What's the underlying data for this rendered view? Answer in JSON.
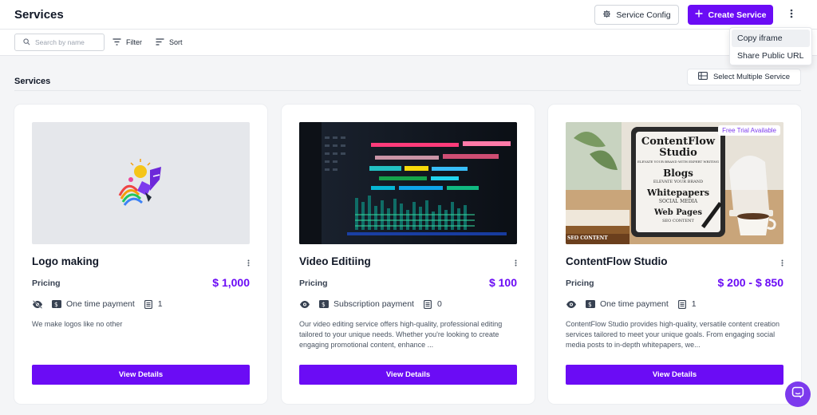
{
  "header": {
    "title": "Services",
    "service_config_label": "Service Config",
    "create_service_label": "Create Service"
  },
  "toolbar": {
    "search_placeholder": "Search by name",
    "filter_label": "Filter",
    "sort_label": "Sort"
  },
  "more_menu": {
    "items": [
      {
        "label": "Copy iframe"
      },
      {
        "label": "Share Public URL"
      }
    ]
  },
  "section": {
    "title": "Services",
    "select_multiple_label": "Select Multiple Service"
  },
  "cards": [
    {
      "title": "Logo making",
      "pricing_label": "Pricing",
      "price": "$ 1,000",
      "visibility_icon": "eye-off-icon",
      "payment_type": "One time payment",
      "count": "1",
      "description": "We make logos like no other",
      "button_label": "View Details"
    },
    {
      "title": "Video Editiing",
      "pricing_label": "Pricing",
      "price": "$ 100",
      "visibility_icon": "eye-icon",
      "payment_type": "Subscription payment",
      "count": "0",
      "description": "Our video editing service offers high-quality, professional editing tailored to your unique needs. Whether you're looking to create engaging promotional content, enhance ...",
      "button_label": "View Details"
    },
    {
      "title": "ContentFlow Studio",
      "pricing_label": "Pricing",
      "price": "$ 200 - $ 850",
      "visibility_icon": "eye-icon",
      "payment_type": "One time payment",
      "count": "1",
      "description": "ContentFlow Studio provides high-quality, versatile content creation services tailored to meet your unique goals. From engaging social media posts to in-depth whitepapers, we...",
      "button_label": "View Details",
      "badge": "Free Trial Available",
      "image_text": {
        "brand": "ContentFlow",
        "brand2": "Studio",
        "tagline": "ELEVATE YOUR BRAND WITH EXPERT WRITING",
        "line1": "Blogs",
        "line2": "ELEVATE YOUR BRAND",
        "line3": "Whitepapers",
        "line4": "SOCIAL MEDIA",
        "line5": "Web Pages",
        "line6": "SEO CONTENT",
        "book": "SEO CONTENT"
      }
    }
  ],
  "colors": {
    "primary": "#6b0cf5",
    "price": "#6b0cf5",
    "badge_text": "#7c3aed"
  }
}
